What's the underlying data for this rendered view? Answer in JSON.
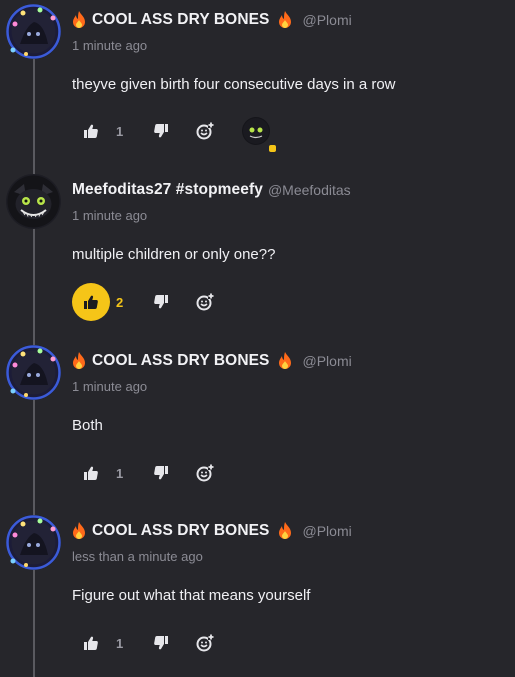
{
  "comments": [
    {
      "name": "COOL ASS DRY BONES",
      "handle": "@Plomi",
      "time": "1 minute ago",
      "text": "theyve given birth four consecutive days in a row",
      "likes": "1",
      "liked": false,
      "has_flames": true
    },
    {
      "name": "Meefoditas27 #stopmeefy",
      "handle": "@Meefoditas",
      "time": "1 minute ago",
      "text": "multiple children or only one??",
      "likes": "2",
      "liked": true,
      "has_flames": false
    },
    {
      "name": "COOL ASS DRY BONES",
      "handle": "@Plomi",
      "time": "1 minute ago",
      "text": "Both",
      "likes": "1",
      "liked": false,
      "has_flames": true
    },
    {
      "name": "COOL ASS DRY BONES",
      "handle": "@Plomi",
      "time": "less than a minute ago",
      "text": "Figure out what that means yourself",
      "likes": "1",
      "liked": false,
      "has_flames": true
    }
  ],
  "colors": {
    "background": "#26262b",
    "accent": "#f5c518",
    "muted": "#8b8b94",
    "flame": "#ff6a1a"
  },
  "icons": [
    "thumbs-up-icon",
    "thumbs-down-icon",
    "add-reaction-icon",
    "flame-icon"
  ]
}
